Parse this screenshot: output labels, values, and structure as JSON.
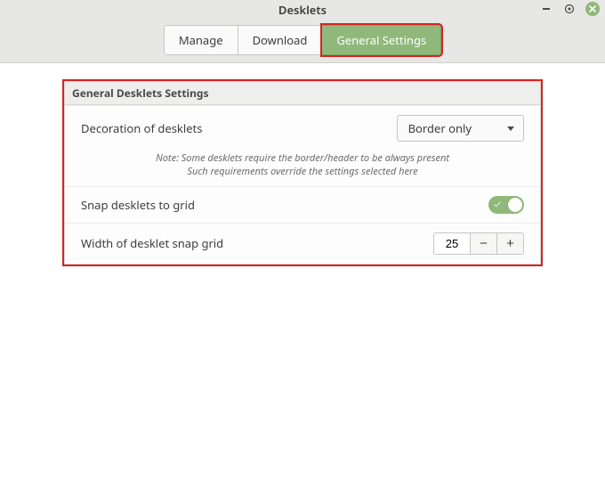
{
  "window": {
    "title": "Desklets"
  },
  "tabs": [
    {
      "label": "Manage",
      "active": false
    },
    {
      "label": "Download",
      "active": false
    },
    {
      "label": "General Settings",
      "active": true
    }
  ],
  "panel": {
    "title": "General Desklets Settings",
    "decoration": {
      "label": "Decoration of desklets",
      "value": "Border only"
    },
    "note_line1": "Note: Some desklets require the border/header to be always present",
    "note_line2": "Such requirements override the settings selected here",
    "snap": {
      "label": "Snap desklets to grid",
      "enabled": true
    },
    "grid_width": {
      "label": "Width of desklet snap grid",
      "value": "25",
      "minus": "−",
      "plus": "+"
    }
  }
}
